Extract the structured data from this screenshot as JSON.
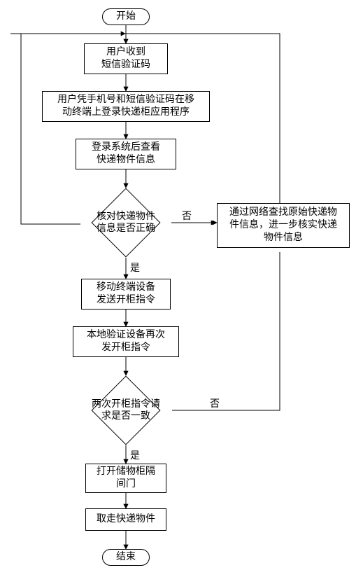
{
  "chart_data": {
    "type": "flowchart",
    "title": "",
    "nodes": [
      {
        "id": "start",
        "type": "terminator",
        "label": "开始"
      },
      {
        "id": "p1",
        "type": "process",
        "label": "用户收到\n短信验证码"
      },
      {
        "id": "p2",
        "type": "process",
        "label": "用户凭手机号和短信验证码在移\n动终端上登录快递柜应用程序"
      },
      {
        "id": "p3",
        "type": "process",
        "label": "登录系统后查看\n快递物件信息"
      },
      {
        "id": "d1",
        "type": "decision",
        "label": "核对快递物件\n信息是否正确"
      },
      {
        "id": "p4",
        "type": "process",
        "label": "移动终端设备\n发送开柜指令"
      },
      {
        "id": "p5",
        "type": "process",
        "label": "本地验证设备再次\n发开柜指令"
      },
      {
        "id": "d2",
        "type": "decision",
        "label": "两次开柜指令请\n求是否一致"
      },
      {
        "id": "p6",
        "type": "process",
        "label": "打开储物柜隔\n间门"
      },
      {
        "id": "p7",
        "type": "process",
        "label": "取走快递物件"
      },
      {
        "id": "side",
        "type": "process",
        "label": "通过网络查找原始快递物\n件信息，进一步核实快递\n物件信息"
      },
      {
        "id": "end",
        "type": "terminator",
        "label": "结束"
      }
    ],
    "edges": [
      {
        "from": "start",
        "to": "p1"
      },
      {
        "from": "p1",
        "to": "p2"
      },
      {
        "from": "p2",
        "to": "p3"
      },
      {
        "from": "p3",
        "to": "d1"
      },
      {
        "from": "d1",
        "to": "p4",
        "label": "是"
      },
      {
        "from": "d1",
        "to": "side",
        "label": "否"
      },
      {
        "from": "side",
        "to": "start_feedback"
      },
      {
        "from": "p4",
        "to": "p5"
      },
      {
        "from": "p5",
        "to": "d2"
      },
      {
        "from": "d2",
        "to": "p6",
        "label": "是"
      },
      {
        "from": "d2",
        "to": "start_feedback",
        "label": "否"
      },
      {
        "from": "p6",
        "to": "p7"
      },
      {
        "from": "p7",
        "to": "end"
      }
    ],
    "labels": {
      "yes": "是",
      "no": "否"
    }
  }
}
